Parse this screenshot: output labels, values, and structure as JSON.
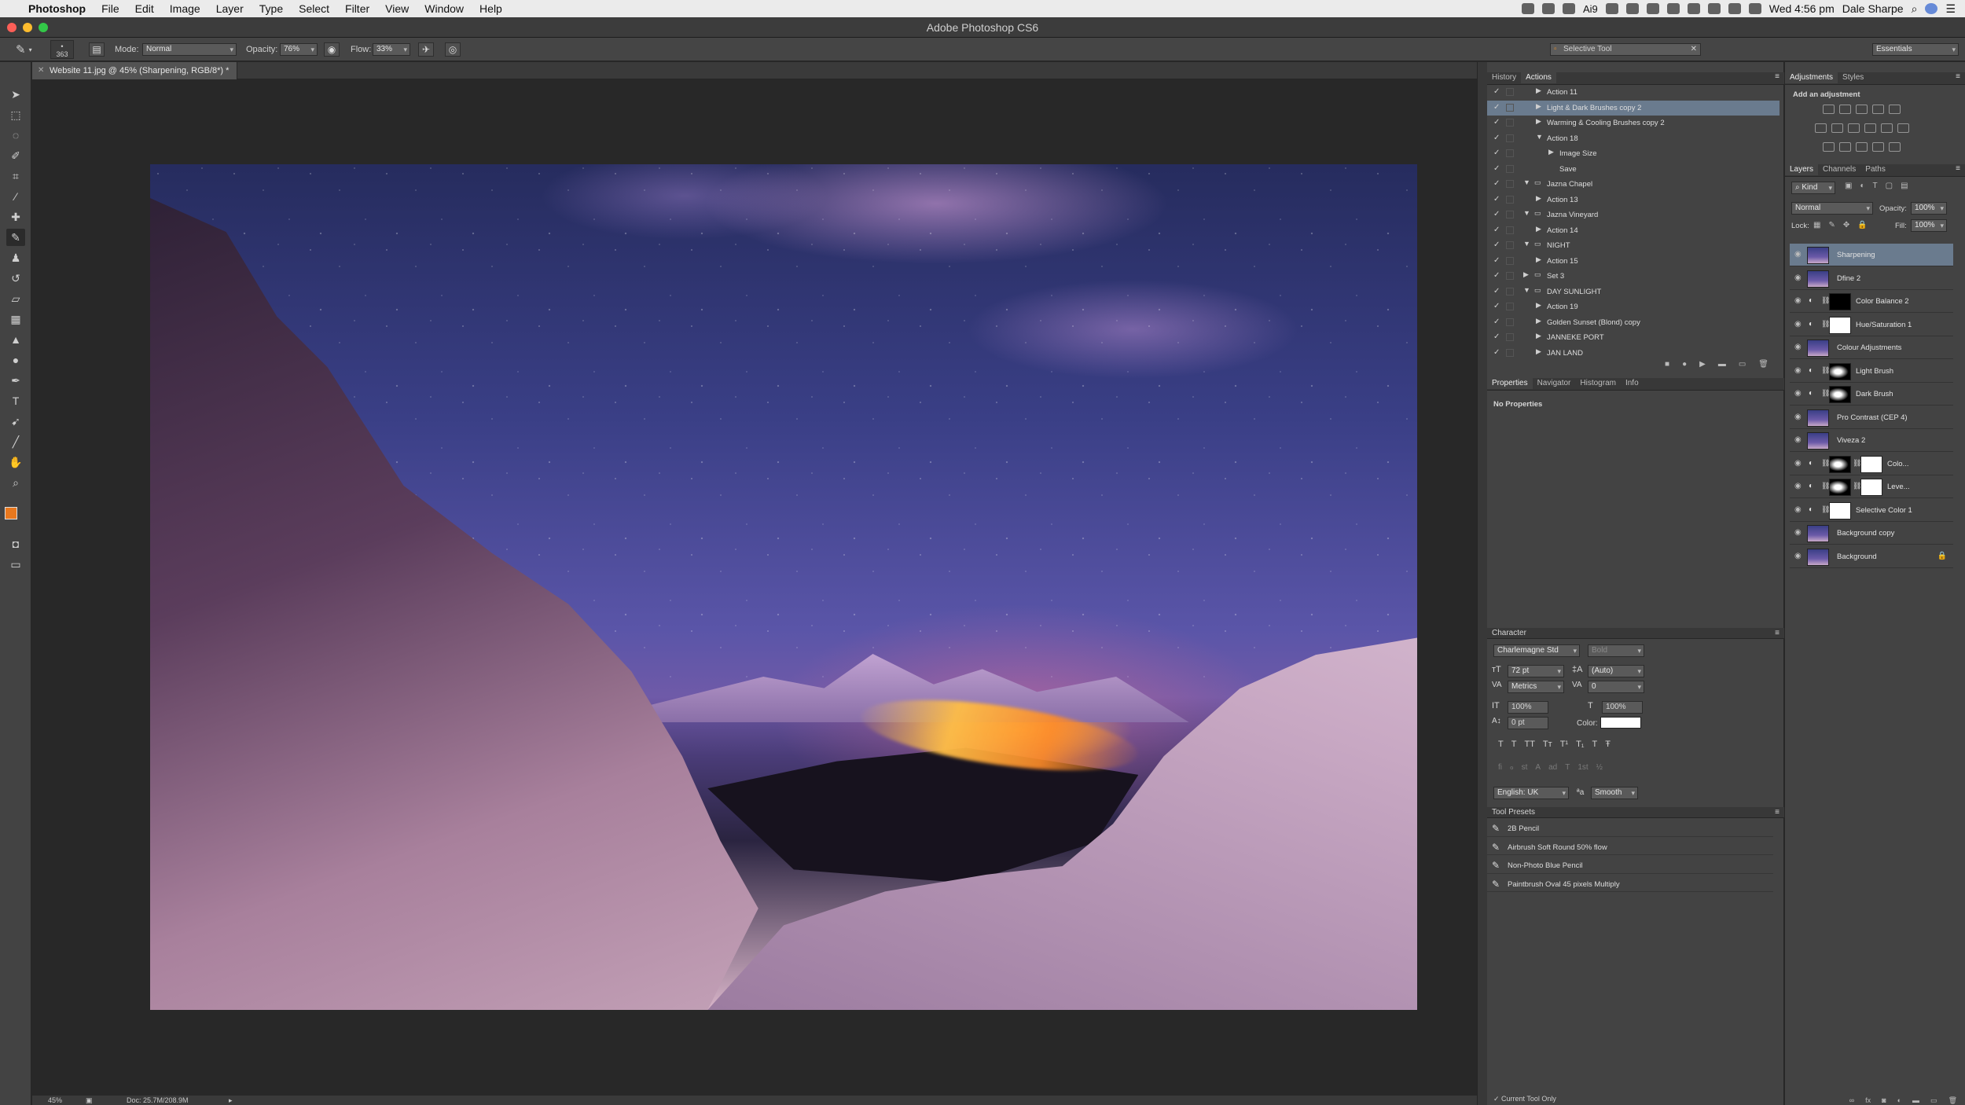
{
  "menubar": {
    "app": "Photoshop",
    "items": [
      "File",
      "Edit",
      "Image",
      "Layer",
      "Type",
      "Select",
      "Filter",
      "View",
      "Window",
      "Help"
    ],
    "right_text": "Wed 4:56 pm",
    "user": "Dale Sharpe",
    "num_indicator": "9"
  },
  "window": {
    "title": "Adobe Photoshop CS6"
  },
  "options": {
    "brush_size": "363",
    "mode_label": "Mode:",
    "mode_value": "Normal",
    "opacity_label": "Opacity:",
    "opacity_value": "76%",
    "flow_label": "Flow:",
    "flow_value": "33%",
    "selective_tool": "Selective Tool",
    "workspace": "Essentials"
  },
  "document": {
    "tab_title": "Website 11.jpg @ 45% (Sharpening, RGB/8*) *"
  },
  "status": {
    "zoom": "45%",
    "doc": "Doc: 25.7M/208.9M"
  },
  "actions_panel": {
    "tabs": [
      "History",
      "Actions"
    ],
    "items": [
      {
        "label": "Action 11",
        "indent": 1,
        "expanded": false,
        "folder": false,
        "selected": false
      },
      {
        "label": "Light & Dark Brushes  copy 2",
        "indent": 1,
        "expanded": false,
        "folder": false,
        "selected": true
      },
      {
        "label": "Warming & Cooling Brushes copy 2",
        "indent": 1,
        "expanded": false,
        "folder": false,
        "selected": false
      },
      {
        "label": "Action 18",
        "indent": 1,
        "expanded": true,
        "folder": false,
        "selected": false
      },
      {
        "label": "Image Size",
        "indent": 2,
        "expanded": false,
        "folder": false,
        "selected": false
      },
      {
        "label": "Save",
        "indent": 2,
        "expanded": null,
        "folder": false,
        "selected": false
      },
      {
        "label": "Jazna Chapel",
        "indent": 0,
        "expanded": true,
        "folder": true,
        "selected": false
      },
      {
        "label": "Action 13",
        "indent": 1,
        "expanded": false,
        "folder": false,
        "selected": false
      },
      {
        "label": "Jazna Vineyard",
        "indent": 0,
        "expanded": true,
        "folder": true,
        "selected": false
      },
      {
        "label": "Action 14",
        "indent": 1,
        "expanded": false,
        "folder": false,
        "selected": false
      },
      {
        "label": "NIGHT",
        "indent": 0,
        "expanded": true,
        "folder": true,
        "selected": false
      },
      {
        "label": "Action 15",
        "indent": 1,
        "expanded": false,
        "folder": false,
        "selected": false
      },
      {
        "label": "Set 3",
        "indent": 0,
        "expanded": false,
        "folder": true,
        "selected": false
      },
      {
        "label": "DAY SUNLIGHT",
        "indent": 0,
        "expanded": true,
        "folder": true,
        "selected": false
      },
      {
        "label": "Action 19",
        "indent": 1,
        "expanded": false,
        "folder": false,
        "selected": false
      },
      {
        "label": "Golden Sunset  (Blond) copy",
        "indent": 1,
        "expanded": false,
        "folder": false,
        "selected": false
      },
      {
        "label": "JANNEKE PORT",
        "indent": 1,
        "expanded": false,
        "folder": false,
        "selected": false
      },
      {
        "label": "JAN LAND",
        "indent": 1,
        "expanded": false,
        "folder": false,
        "selected": false
      }
    ]
  },
  "properties_panel": {
    "tabs": [
      "Properties",
      "Navigator",
      "Histogram",
      "Info"
    ],
    "message": "No Properties"
  },
  "character_panel": {
    "title": "Character",
    "font": "Charlemagne Std",
    "style": "Bold",
    "size": "72 pt",
    "leading": "(Auto)",
    "kerning": "Metrics",
    "tracking": "0",
    "vscale": "100%",
    "hscale": "100%",
    "baseline": "0 pt",
    "color_label": "Color:",
    "language": "English: UK",
    "aa_label": "a",
    "antialias": "Smooth",
    "style_buttons": [
      "T",
      "T",
      "TT",
      "Tт",
      "T¹",
      "T₁",
      "T",
      "Ŧ"
    ],
    "ot_buttons": [
      "fi",
      "ℴ",
      "st",
      "A",
      "ad",
      "T",
      "1st",
      "½"
    ]
  },
  "tool_presets": {
    "title": "Tool Presets",
    "items": [
      "2B Pencil",
      "Airbrush Soft Round 50% flow",
      "Non-Photo Blue Pencil",
      "Paintbrush Oval 45 pixels Multiply"
    ],
    "footer": "Current Tool Only"
  },
  "adjustments_panel": {
    "tabs": [
      "Adjustments",
      "Styles"
    ],
    "heading": "Add an adjustment"
  },
  "layers_panel": {
    "tabs": [
      "Layers",
      "Channels",
      "Paths"
    ],
    "filter": "Kind",
    "blend": "Normal",
    "opacity_label": "Opacity:",
    "opacity": "100%",
    "lock_label": "Lock:",
    "fill_label": "Fill:",
    "fill": "100%",
    "layers": [
      {
        "name": "Sharpening",
        "kind": "photo",
        "selected": true
      },
      {
        "name": "Dfine 2",
        "kind": "photo",
        "selected": false
      },
      {
        "name": "Color Balance 2",
        "kind": "adj-black",
        "selected": false
      },
      {
        "name": "Hue/Saturation 1",
        "kind": "adj-white",
        "selected": false
      },
      {
        "name": "Colour Adjustments",
        "kind": "photo",
        "selected": false
      },
      {
        "name": "Light Brush",
        "kind": "adj-mask",
        "selected": false
      },
      {
        "name": "Dark Brush",
        "kind": "adj-mask",
        "selected": false
      },
      {
        "name": "Pro Contrast (CEP 4)",
        "kind": "photo",
        "selected": false
      },
      {
        "name": "Viveza 2",
        "kind": "photo",
        "selected": false
      },
      {
        "name": "Colo...",
        "kind": "adj-two",
        "selected": false
      },
      {
        "name": "Leve...",
        "kind": "adj-two",
        "selected": false
      },
      {
        "name": "Selective Color 1",
        "kind": "adj-white",
        "selected": false
      },
      {
        "name": "Background copy",
        "kind": "photo",
        "selected": false
      },
      {
        "name": "Background",
        "kind": "photo-lock",
        "selected": false
      }
    ]
  },
  "colors": {
    "foreground": "#e8781e",
    "background": "#000000",
    "accent": "#6a7b8e"
  }
}
